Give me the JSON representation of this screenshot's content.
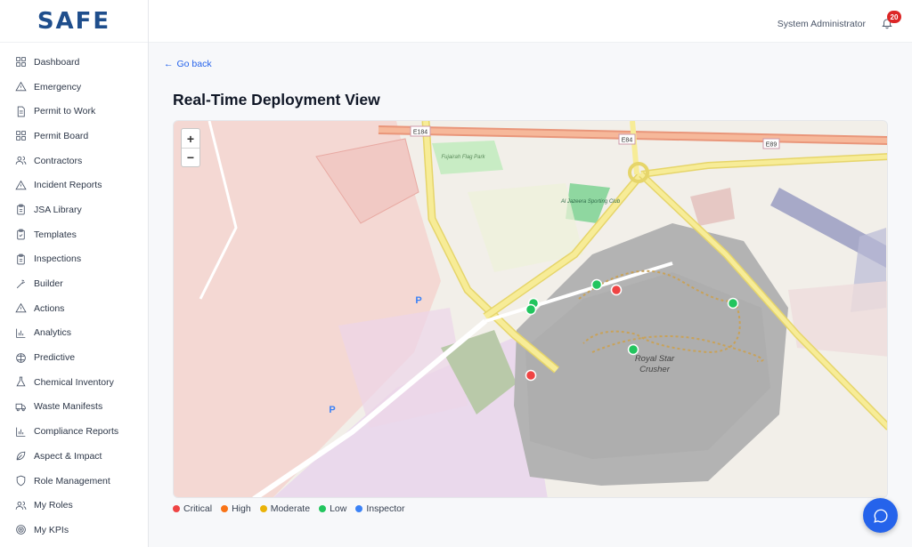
{
  "app": {
    "logo_text": "SAFE"
  },
  "sidebar": {
    "items": [
      {
        "label": "Dashboard",
        "icon": "grid-icon"
      },
      {
        "label": "Emergency",
        "icon": "warning-icon"
      },
      {
        "label": "Permit to Work",
        "icon": "document-icon"
      },
      {
        "label": "Permit Board",
        "icon": "grid-icon"
      },
      {
        "label": "Contractors",
        "icon": "users-icon"
      },
      {
        "label": "Incident Reports",
        "icon": "warning-icon"
      },
      {
        "label": "JSA Library",
        "icon": "clipboard-icon"
      },
      {
        "label": "Templates",
        "icon": "clipboard-check-icon"
      },
      {
        "label": "Inspections",
        "icon": "clipboard-icon"
      },
      {
        "label": "Builder",
        "icon": "wand-icon"
      },
      {
        "label": "Actions",
        "icon": "warning-icon"
      },
      {
        "label": "Analytics",
        "icon": "bar-chart-icon"
      },
      {
        "label": "Predictive",
        "icon": "brain-icon"
      },
      {
        "label": "Chemical Inventory",
        "icon": "flask-icon"
      },
      {
        "label": "Waste Manifests",
        "icon": "truck-icon"
      },
      {
        "label": "Compliance Reports",
        "icon": "bar-chart-icon"
      },
      {
        "label": "Aspect & Impact",
        "icon": "leaf-icon"
      },
      {
        "label": "Role Management",
        "icon": "shield-icon"
      },
      {
        "label": "My Roles",
        "icon": "users-icon"
      },
      {
        "label": "My KPIs",
        "icon": "target-icon"
      }
    ]
  },
  "header": {
    "user_name": "System Administrator",
    "notification_count": "20"
  },
  "page": {
    "back_label": "Go back",
    "title": "Real-Time Deployment View"
  },
  "map": {
    "zoom_in": "+",
    "zoom_out": "−",
    "labels": {
      "road_e184": "E184",
      "road_e84": "E84",
      "road_e89": "E89",
      "park": "Fujairah Flag Park",
      "club": "Al Jazeera Sporting Club",
      "crusher_line1": "Royal Star",
      "crusher_line2": "Crusher",
      "parking": "P"
    },
    "markers": [
      {
        "level": "Low",
        "color": "#22c55e"
      },
      {
        "level": "Critical",
        "color": "#ef4444"
      },
      {
        "level": "Low",
        "color": "#22c55e"
      },
      {
        "level": "Low",
        "color": "#22c55e"
      },
      {
        "level": "Low",
        "color": "#22c55e"
      },
      {
        "level": "Low",
        "color": "#22c55e"
      },
      {
        "level": "Critical",
        "color": "#ef4444"
      }
    ]
  },
  "legend": [
    {
      "label": "Critical",
      "color": "#ef4444"
    },
    {
      "label": "High",
      "color": "#f97316"
    },
    {
      "label": "Moderate",
      "color": "#eab308"
    },
    {
      "label": "Low",
      "color": "#22c55e"
    },
    {
      "label": "Inspector",
      "color": "#3b82f6"
    }
  ],
  "colors": {
    "brand": "#1f4e8c",
    "accent": "#2563eb",
    "badge": "#dc2626"
  }
}
